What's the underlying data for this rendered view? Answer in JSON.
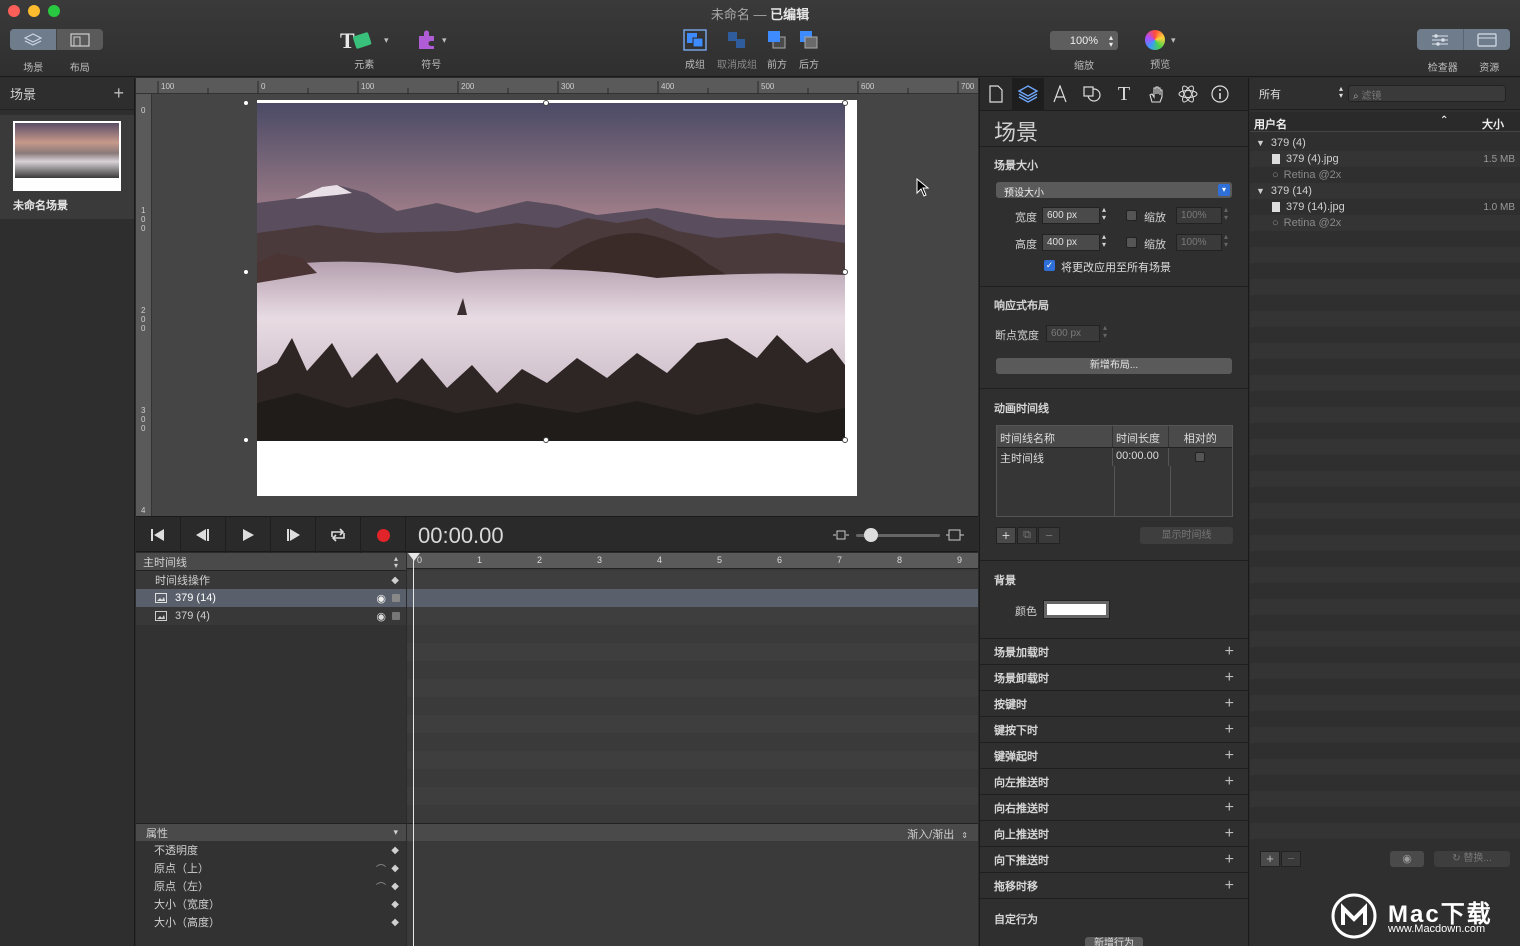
{
  "window": {
    "title_prefix": "未命名",
    "title_sep": "—",
    "title_state": "已编辑"
  },
  "toolbar": {
    "scene_label": "场景",
    "layout_label": "布局",
    "elements_label": "元素",
    "symbols_label": "符号",
    "group_label": "成组",
    "ungroup_label": "取消成组",
    "front_label": "前方",
    "back_label": "后方",
    "zoom_value": "100%",
    "zoom_label": "缩放",
    "preview_label": "预览",
    "inspector_label": "检查器",
    "resources_label": "资源"
  },
  "scenes": {
    "title": "场景",
    "add": "+",
    "items": [
      {
        "name": "未命名场景"
      }
    ]
  },
  "ruler": {
    "top": [
      "100",
      "0",
      "100",
      "200",
      "300",
      "400",
      "500",
      "600",
      "700"
    ],
    "left": [
      "0",
      "100",
      "200",
      "300",
      "4"
    ]
  },
  "transport": {
    "timecode": "00:00.00"
  },
  "timeline": {
    "header": "主时间线",
    "rows": [
      {
        "label": "时间线操作"
      },
      {
        "label": "379 (14)"
      },
      {
        "label": "379 (4)"
      }
    ],
    "ticks": [
      "0",
      "1",
      "2",
      "3",
      "4",
      "5",
      "6",
      "7",
      "8",
      "9"
    ],
    "properties_header": "属性",
    "easing": "渐入/渐出",
    "properties": [
      "不透明度",
      "原点（上）",
      "原点（左）",
      "大小（宽度）",
      "大小（高度）"
    ]
  },
  "inspector": {
    "heading": "场景",
    "scene_size": {
      "title": "场景大小",
      "preset": "预设大小",
      "width_label": "宽度",
      "width_value": "600 px",
      "height_label": "高度",
      "height_value": "400 px",
      "scale_label": "缩放",
      "scale_value": "100%",
      "apply_all": "将更改应用至所有场景"
    },
    "responsive": {
      "title": "响应式布局",
      "breakpoint_label": "断点宽度",
      "breakpoint_value": "600 px",
      "add_layout": "新增布局..."
    },
    "timelines": {
      "title": "动画时间线",
      "col_name": "时间线名称",
      "col_duration": "时间长度",
      "col_relative": "相对的",
      "row_name": "主时间线",
      "row_duration": "00:00.00",
      "show_button": "显示时间线"
    },
    "background": {
      "title": "背景",
      "color_label": "颜色",
      "color": "#ffffff"
    },
    "events": [
      "场景加载时",
      "场景卸载时",
      "按键时",
      "键按下时",
      "键弹起时",
      "向左推送时",
      "向右推送时",
      "向上推送时",
      "向下推送时",
      "拖移时移"
    ],
    "custom": {
      "title": "自定行为",
      "new_button": "新增行为"
    }
  },
  "resources": {
    "filter_select": "所有",
    "filter_placeholder": "滤镜",
    "col_name": "用户名",
    "col_size": "大小",
    "groups": [
      {
        "name": "379 (4)",
        "file": "379 (4).jpg",
        "size": "1.5 MB",
        "retina": "Retina @2x"
      },
      {
        "name": "379 (14)",
        "file": "379 (14).jpg",
        "size": "1.0 MB",
        "retina": "Retina @2x"
      }
    ],
    "replace_button": "替换..."
  },
  "watermark": {
    "brand": "Mac下载",
    "url": "www.Macdown.com"
  },
  "colors": {
    "accent": "#2f6fd8",
    "record": "#e0242a",
    "selected_row": "#59606b"
  }
}
